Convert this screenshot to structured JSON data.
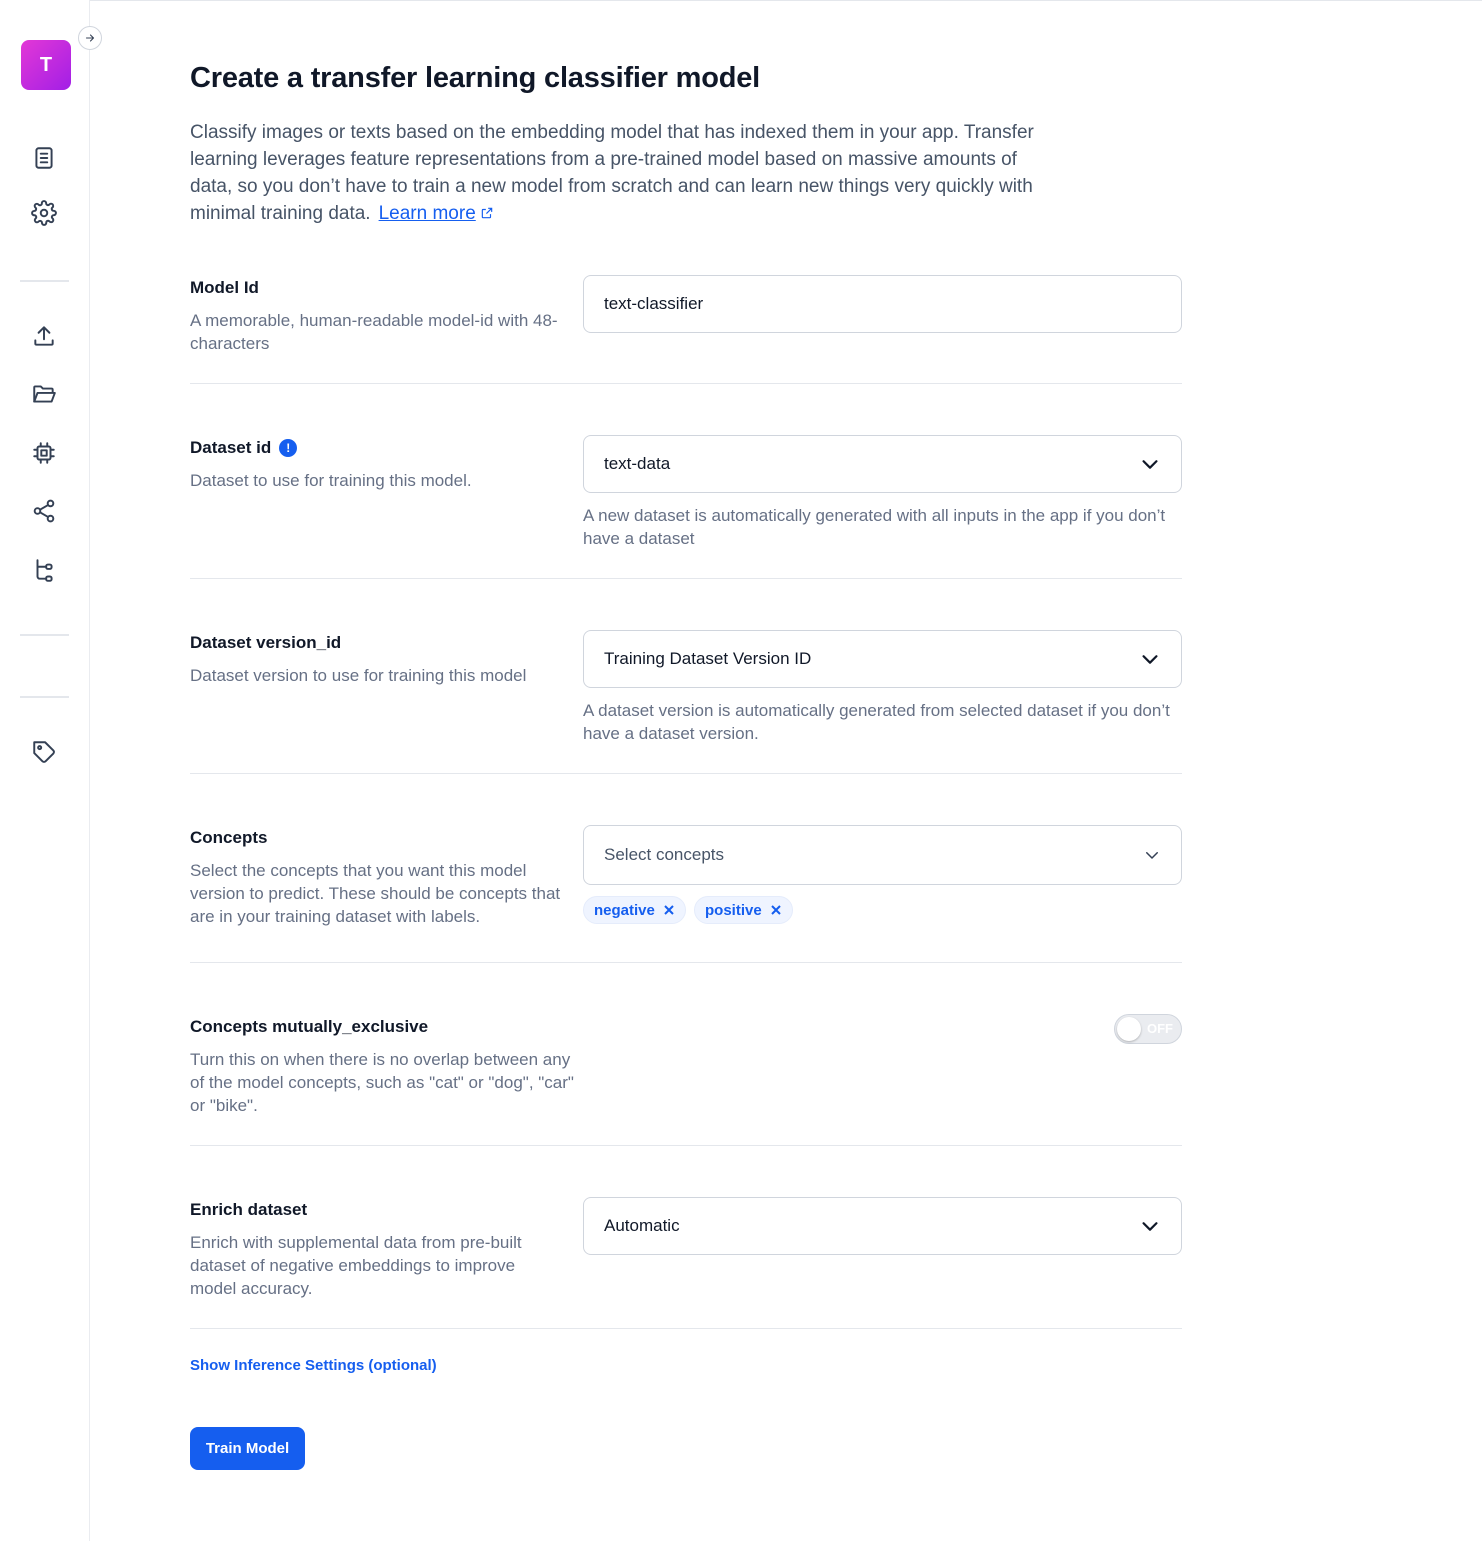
{
  "sidebar": {
    "avatar_letter": "T",
    "icons": [
      "document-icon",
      "settings-icon",
      "upload-icon",
      "folder-icon",
      "chip-icon",
      "share-icon",
      "workflow-icon",
      "tag-icon"
    ]
  },
  "page": {
    "title": "Create a transfer learning classifier model",
    "intro": "Classify images or texts based on the embedding model that has indexed them in your app. Transfer learning leverages feature representations from a pre-trained model based on massive amounts of data, so you don’t have to train a new model from scratch and can learn new things very quickly with minimal training data.",
    "learn_more": "Learn more"
  },
  "form": {
    "model_id": {
      "label": "Model Id",
      "description": "A memorable, human-readable model-id with 48-characters",
      "value": "text-classifier"
    },
    "dataset_id": {
      "label": "Dataset id",
      "info_icon": "!",
      "description": "Dataset to use for training this model.",
      "value": "text-data",
      "helper": "A new dataset is automatically generated with all inputs in the app if you don’t have a dataset"
    },
    "dataset_version": {
      "label": "Dataset version_id",
      "description": "Dataset version to use for training this model",
      "value": "Training Dataset Version ID",
      "helper": "A dataset version is automatically generated from selected dataset if you don’t have a dataset version."
    },
    "concepts": {
      "label": "Concepts",
      "description": "Select the concepts that you want this model version to predict. These should be concepts that are in your training dataset with labels.",
      "placeholder": "Select concepts",
      "selected": [
        "negative",
        "positive"
      ]
    },
    "mutually_exclusive": {
      "label": "Concepts mutually_exclusive",
      "description": "Turn this on when there is no overlap between any of the model concepts, such as \"cat\" or \"dog\", \"car\" or \"bike\".",
      "toggle_state": "OFF"
    },
    "enrich": {
      "label": "Enrich dataset",
      "description": "Enrich with supplemental data from pre-built dataset of negative embeddings to improve model accuracy.",
      "value": "Automatic"
    }
  },
  "actions": {
    "inference_link": "Show Inference Settings (optional)",
    "train_button": "Train Model"
  },
  "colors": {
    "accent": "#155eef",
    "avatar_gradient_start": "#e338d6",
    "avatar_gradient_end": "#a21fe6"
  }
}
